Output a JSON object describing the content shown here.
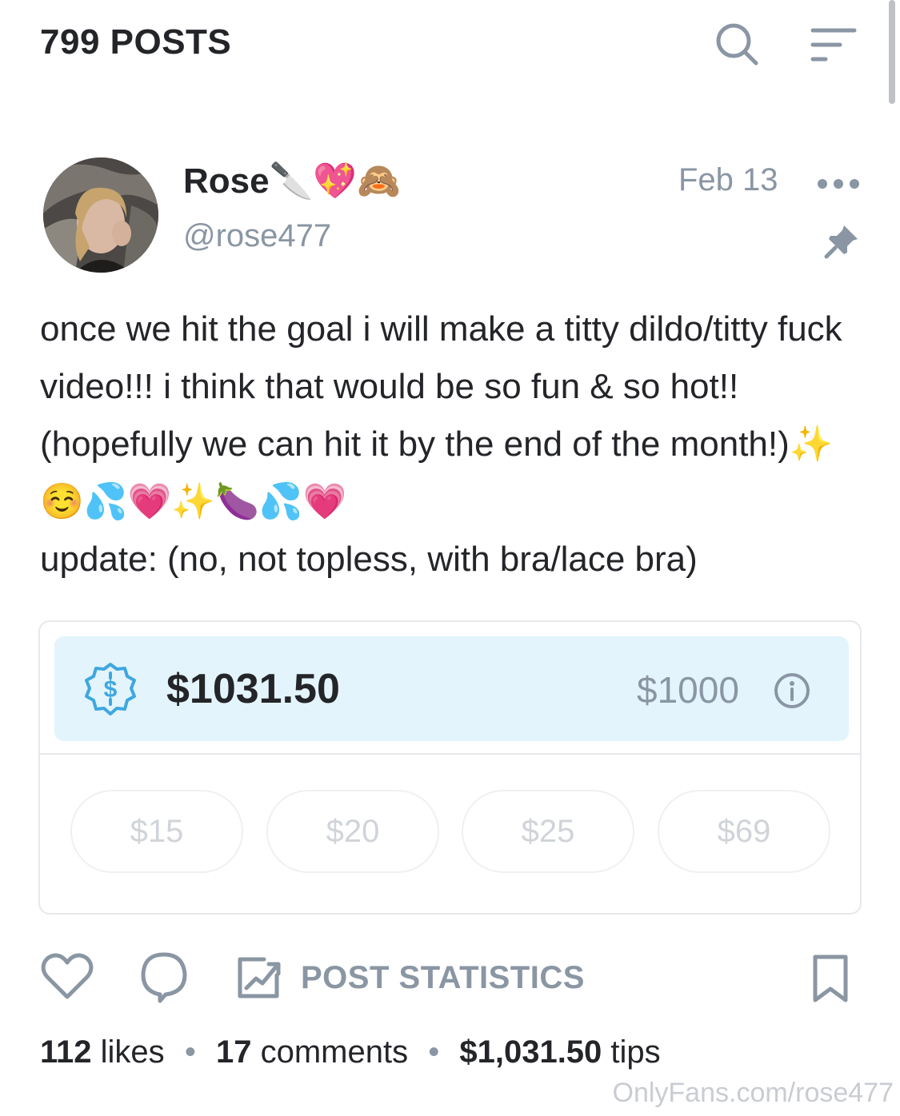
{
  "header": {
    "title": "799 POSTS"
  },
  "author": {
    "name": "Rose🔪💖🙈",
    "handle": "@rose477"
  },
  "post": {
    "date": "Feb 13",
    "paragraphs": [
      "once we hit the goal i will make a titty dildo/titty fuck video!!! i think that would be so fun & so hot!! (hopefully we can hit it by the end of the month!)✨☺️💦💗✨🍆💦💗",
      "update: (no, not topless, with bra/lace bra)"
    ]
  },
  "tip_goal": {
    "raised": "$1031.50",
    "target": "$1000",
    "progress_fraction": 1.0,
    "tip_options": [
      "$15",
      "$20",
      "$25",
      "$69"
    ]
  },
  "actions": {
    "statistics_label": "POST STATISTICS"
  },
  "meta": {
    "likes_count": "112",
    "likes_label": "likes",
    "comments_count": "17",
    "comments_label": "comments",
    "tips_amount": "$1,031.50",
    "tips_label": "tips",
    "separator": "•"
  },
  "watermark": "OnlyFans.com/rose477",
  "colors": {
    "primary_text": "#242529",
    "muted_text": "#8a96a3",
    "goal_background": "#e3f4fc",
    "accent_blue": "#3ea7e0",
    "border": "#e7e8ec"
  }
}
